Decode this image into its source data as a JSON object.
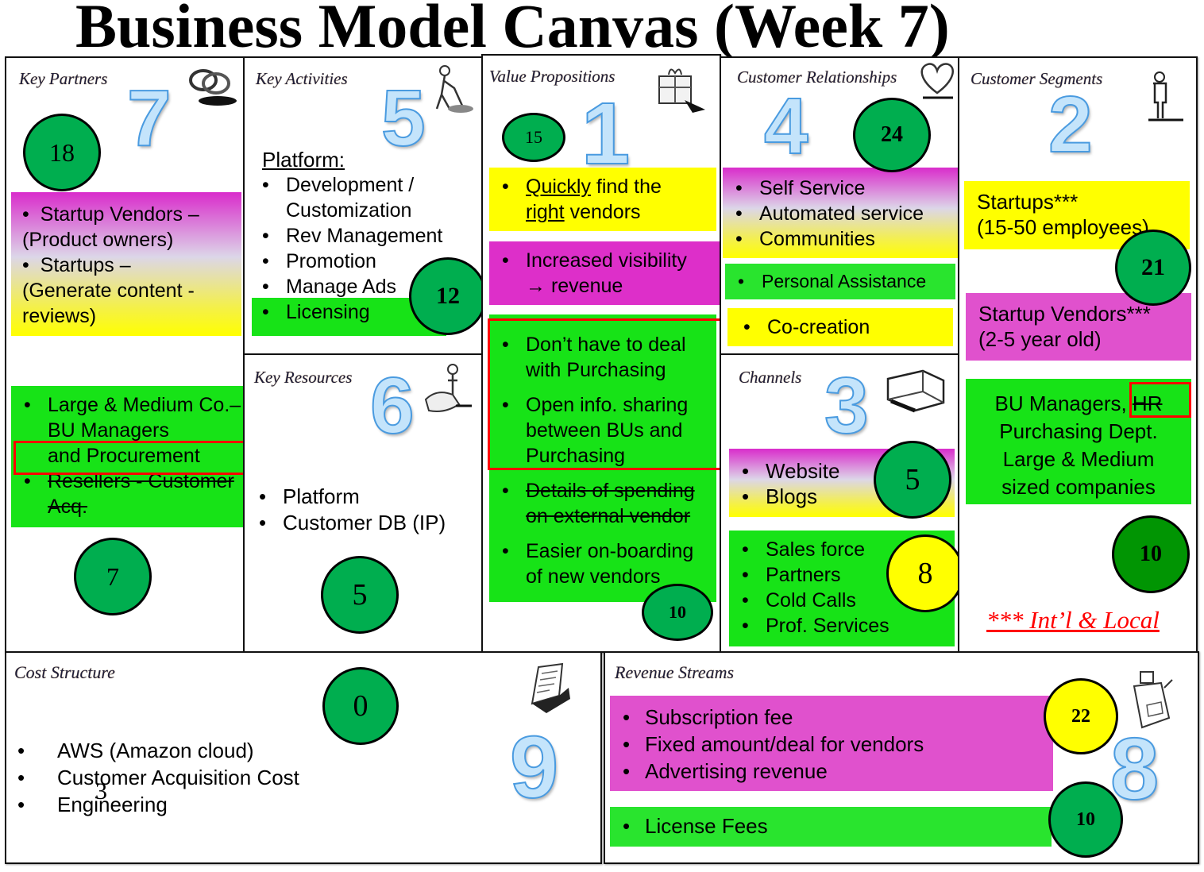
{
  "title": "Business Model Canvas (Week 7)",
  "colors": {
    "sticky_green": "#17e317",
    "sticky_yellow": "#ffff00",
    "sticky_magenta": "#dd2fc9",
    "badge_green": "#00ae4f",
    "badge_dark_green": "#019503",
    "badge_yellow": "#ffff00",
    "highlight_red": "#ff0000",
    "step_number_blue": "#c4e4fb"
  },
  "key_partners": {
    "title": "Key Partners",
    "step": "7",
    "icon": "chain-link-icon",
    "badges": [
      "18",
      "7"
    ],
    "sticky1": {
      "items": [
        "Startup Vendors –",
        "(Product owners)",
        "Startups –",
        "(Generate content -",
        "reviews)"
      ]
    },
    "sticky2": {
      "items": [
        "Large & Medium Co.– BU Managers",
        "and Procurement",
        "Resellers - Customer Acq."
      ],
      "struck": [
        "Resellers - Customer Acq."
      ],
      "highlighted": "and Procurement"
    }
  },
  "key_activities": {
    "title": "Key Activities",
    "step": "5",
    "icon": "worker-icon",
    "badge": "12",
    "heading": "Platform:",
    "items": [
      "Development / Customization",
      "Rev Management",
      "Promotion",
      "Manage Ads",
      "Licensing"
    ]
  },
  "key_resources": {
    "title": "Key Resources",
    "step": "6",
    "icon": "resources-icon",
    "badge": "5",
    "items": [
      "Platform",
      "Customer DB (IP)"
    ]
  },
  "value_propositions": {
    "title": "Value Propositions",
    "step": "1",
    "icon": "gift-icon",
    "badges": [
      "15",
      "10"
    ],
    "sticky1": {
      "underlined1": "Quickly",
      "text1": " find the",
      "underlined2": "right",
      "text2": " vendors"
    },
    "sticky2": {
      "items": [
        "Increased visibility → revenue"
      ]
    },
    "sticky3": {
      "items": [
        "Don’t have to deal with Purchasing",
        "Open info. sharing between BUs and Purchasing",
        "Details of spending on external vendor",
        "Easier on-boarding of new vendors"
      ],
      "struck": [
        "Details of spending on external vendor"
      ]
    }
  },
  "customer_relationships": {
    "title": "Customer Relationships",
    "step": "4",
    "icon": "heart-icon",
    "badge": "24",
    "sticky1": {
      "items": [
        "Self Service",
        "Automated service",
        "Communities"
      ]
    },
    "sticky2": {
      "items": [
        "Personal Assistance"
      ]
    },
    "sticky3": {
      "items": [
        "Co-creation"
      ]
    }
  },
  "channels": {
    "title": "Channels",
    "step": "3",
    "icon": "truck-icon",
    "badges": [
      "5",
      "8"
    ],
    "sticky1": {
      "items": [
        "Website",
        "Blogs"
      ]
    },
    "sticky2": {
      "items": [
        "Sales force",
        "Partners",
        "Cold Calls",
        "Prof. Services"
      ]
    }
  },
  "customer_segments": {
    "title": "Customer Segments",
    "step": "2",
    "icon": "person-icon",
    "badges": [
      "21",
      "10"
    ],
    "sticky1": {
      "line1": "Startups***",
      "line2": "(15-50 employees)"
    },
    "sticky2": {
      "line1": "Startup Vendors***",
      "line2": "(2-5 year old)"
    },
    "sticky3": {
      "line1a": "BU Managers, ",
      "line1b_struck": "HR",
      "line2": "Purchasing Dept.",
      "line3": "Large & Medium",
      "line4": "sized companies"
    },
    "note": "*** Int’l & Local"
  },
  "cost_structure": {
    "title": "Cost Structure",
    "step": "9",
    "icon": "receipt-icon",
    "badge": "0",
    "items": [
      "AWS (Amazon cloud)",
      "Customer Acquisition Cost",
      "Engineering"
    ],
    "stray_text": "3"
  },
  "revenue_streams": {
    "title": "Revenue Streams",
    "step": "8",
    "icon": "cash-register-icon",
    "badges": [
      "22",
      "10"
    ],
    "sticky1": {
      "items": [
        "Subscription fee",
        "Fixed amount/deal for vendors",
        "Advertising revenue"
      ]
    },
    "sticky2": {
      "items": [
        "License Fees"
      ]
    }
  }
}
